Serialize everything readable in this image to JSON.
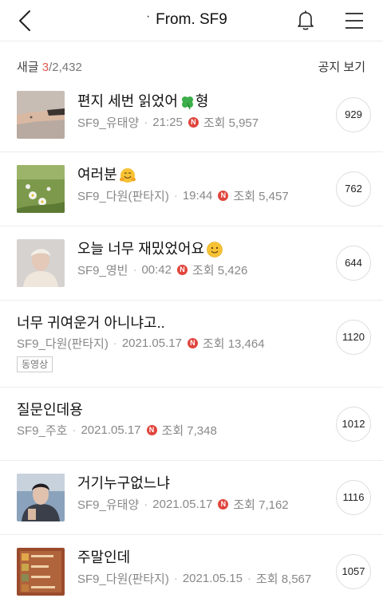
{
  "header": {
    "title": "From. SF9",
    "dot": "·",
    "back_icon": "chevron-left-icon",
    "bell_icon": "bell-icon",
    "menu_icon": "hamburger-menu-icon"
  },
  "subbar": {
    "label": "새글",
    "current": "3",
    "separator": "/",
    "total": "2,432",
    "notice_label": "공지 보기"
  },
  "colors": {
    "accent_red": "#e35a52",
    "badge_red": "#e0453d",
    "text_gray": "#888888"
  },
  "posts": [
    {
      "title": "편지 세번 읽었어",
      "title_suffix": "형",
      "emoji": "four-leaf-clover",
      "author": "SF9_유태양",
      "time": "21:25",
      "is_new": true,
      "new_badge": "N",
      "views_label": "조회 5,957",
      "comments": "929",
      "has_thumb": true,
      "thumb": "hand-photo"
    },
    {
      "title": "여러분",
      "title_suffix": "",
      "emoji": "hugging-face",
      "author": "SF9_다원(판타지)",
      "time": "19:44",
      "is_new": true,
      "new_badge": "N",
      "views_label": "조회 5,457",
      "comments": "762",
      "has_thumb": true,
      "thumb": "flowers-photo"
    },
    {
      "title": "오늘 너무 재밌었어요",
      "title_suffix": "",
      "emoji": "smiling-face",
      "author": "SF9_영빈",
      "time": "00:42",
      "is_new": true,
      "new_badge": "N",
      "views_label": "조회 5,426",
      "comments": "644",
      "has_thumb": true,
      "thumb": "portrait-photo"
    },
    {
      "title": "너무 귀여운거 아니냐고..",
      "title_suffix": "",
      "emoji": "",
      "author": "SF9_다원(판타지)",
      "time": "2021.05.17",
      "is_new": true,
      "new_badge": "N",
      "views_label": "조회 13,464",
      "comments": "1120",
      "has_thumb": false,
      "tag": "동영상"
    },
    {
      "title": "질문인데용",
      "title_suffix": "",
      "emoji": "",
      "author": "SF9_주호",
      "time": "2021.05.17",
      "is_new": true,
      "new_badge": "N",
      "views_label": "조회 7,348",
      "comments": "1012",
      "has_thumb": false
    },
    {
      "title": "거기누구없느냐",
      "title_suffix": "",
      "emoji": "",
      "author": "SF9_유태양",
      "time": "2021.05.17",
      "is_new": true,
      "new_badge": "N",
      "views_label": "조회 7,162",
      "comments": "1116",
      "has_thumb": true,
      "thumb": "selfie-photo"
    },
    {
      "title": "주말인데",
      "title_suffix": "",
      "emoji": "",
      "author": "SF9_다원(판타지)",
      "time": "2021.05.15",
      "is_new": false,
      "views_label": "조회 8,567",
      "comments": "1057",
      "has_thumb": true,
      "thumb": "playlist-photo"
    }
  ]
}
